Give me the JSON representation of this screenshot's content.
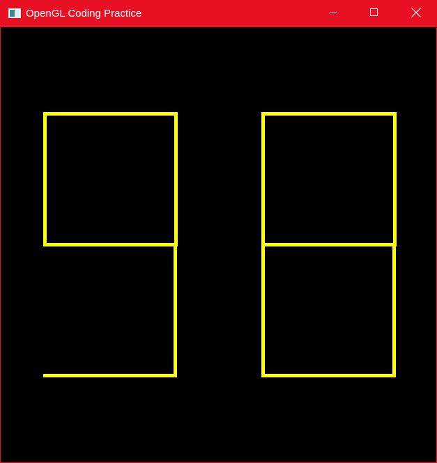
{
  "window": {
    "title": "OpenGL Coding Practice",
    "icon": "application-window-icon",
    "controls": [
      "minimize-icon",
      "maximize-icon",
      "close-icon"
    ]
  },
  "canvas": {
    "background_color": "#000000",
    "stroke_color": "#ffff00",
    "digits": [
      "9",
      "8"
    ]
  },
  "colors": {
    "titlebar": "#e81123",
    "title_text": "#ffffff"
  }
}
